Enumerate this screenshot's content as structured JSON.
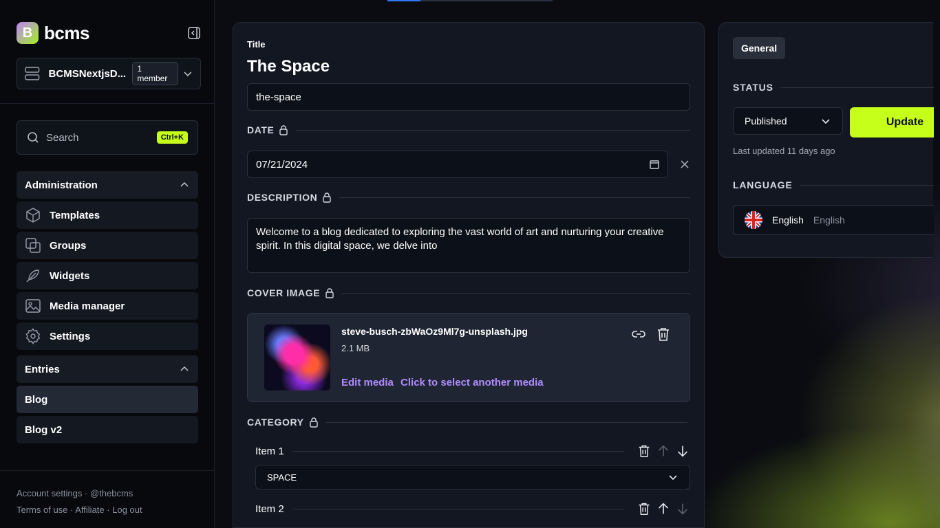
{
  "brand": {
    "name": "bcms",
    "mark": "B"
  },
  "org": {
    "name": "BCMSNextjsD...",
    "members": "1 member"
  },
  "search": {
    "label": "Search",
    "shortcut": "Ctrl+K"
  },
  "nav": {
    "admin_header": "Administration",
    "admin_items": [
      {
        "label": "Templates",
        "icon": "cube-icon"
      },
      {
        "label": "Groups",
        "icon": "groups-icon"
      },
      {
        "label": "Widgets",
        "icon": "feather-icon"
      },
      {
        "label": "Media manager",
        "icon": "image-icon"
      },
      {
        "label": "Settings",
        "icon": "gear-icon"
      }
    ],
    "entries_header": "Entries",
    "entries_items": [
      {
        "label": "Blog",
        "active": true
      },
      {
        "label": "Blog v2",
        "active": false
      }
    ]
  },
  "footer": {
    "line1": "Account settings · @thebcms",
    "line2": "Terms of use · Affiliate · Log out"
  },
  "entry": {
    "title_label": "Title",
    "title_value": "The Space",
    "slug_value": "the-space",
    "date_label": "DATE",
    "date_value": "07/21/2024",
    "description_label": "DESCRIPTION",
    "description_value": "Welcome to a blog dedicated to exploring the vast world of art and nurturing your creative spirit. In this digital space, we delve into",
    "cover_label": "COVER IMAGE",
    "cover": {
      "file_name": "steve-busch-zbWaOz9Ml7g-unsplash.jpg",
      "file_size": "2.1 MB",
      "edit_label": "Edit media",
      "select_label": "Click to select another media"
    },
    "category_label": "CATEGORY",
    "category_items": [
      {
        "label": "Item 1",
        "value": "SPACE"
      },
      {
        "label": "Item 2"
      }
    ]
  },
  "panel": {
    "tab": "General",
    "status_label": "STATUS",
    "status_value": "Published",
    "update_label": "Update",
    "last_updated": "Last updated 11 days ago",
    "language_label": "LANGUAGE",
    "language_name": "English",
    "language_native": "English"
  },
  "colors": {
    "accent": "#c6ff1a",
    "link": "#b08cff",
    "card": "#121722"
  }
}
